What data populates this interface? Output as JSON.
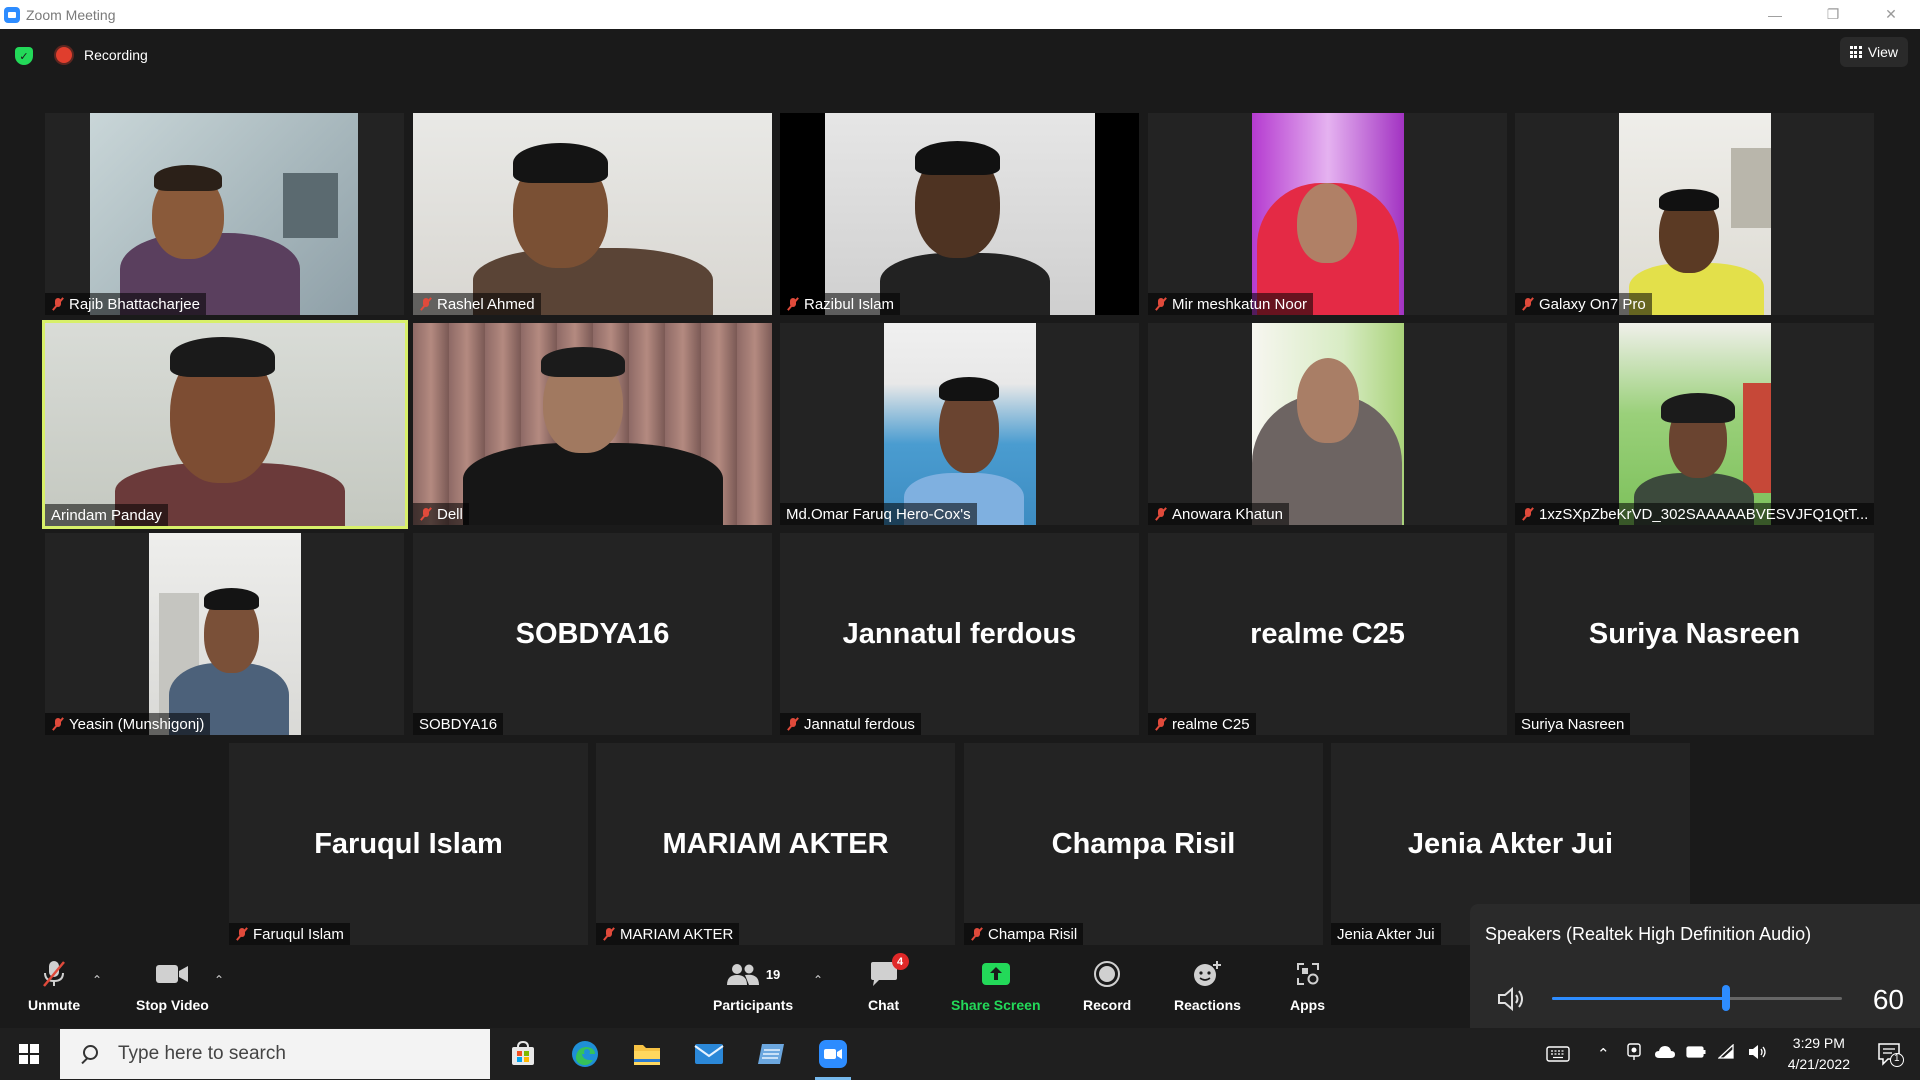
{
  "window": {
    "title": "Zoom Meeting"
  },
  "topbar": {
    "recording_label": "Recording",
    "view_label": "View"
  },
  "participants": [
    {
      "name": "Rajib Bhattacharjee",
      "muted": true,
      "video": true
    },
    {
      "name": "Rashel Ahmed",
      "muted": true,
      "video": true
    },
    {
      "name": "Razibul Islam",
      "muted": true,
      "video": true
    },
    {
      "name": "Mir meshkatun Noor",
      "muted": true,
      "video": true
    },
    {
      "name": "Galaxy On7 Pro",
      "muted": true,
      "video": true
    },
    {
      "name": "Arindam Panday",
      "muted": false,
      "video": true,
      "speaking": true
    },
    {
      "name": "Dell",
      "muted": true,
      "video": true
    },
    {
      "name": "Md.Omar Faruq Hero-Cox's",
      "muted": false,
      "video": true
    },
    {
      "name": "Anowara Khatun",
      "muted": true,
      "video": true
    },
    {
      "name": "1xzSXpZbeKrVD_302SAAAAABVESVJFQ1QtT...",
      "muted": true,
      "video": true
    },
    {
      "name": "Yeasin (Munshigonj)",
      "muted": true,
      "video": true
    },
    {
      "name": "SOBDYA16",
      "muted": false,
      "video": false
    },
    {
      "name": "Jannatul ferdous",
      "muted": true,
      "video": false
    },
    {
      "name": "realme C25",
      "muted": true,
      "video": false
    },
    {
      "name": "Suriya Nasreen",
      "muted": false,
      "video": false
    },
    {
      "name": "Faruqul Islam",
      "muted": true,
      "video": false
    },
    {
      "name": "MARIAM AKTER",
      "muted": true,
      "video": false
    },
    {
      "name": "Champa Risil",
      "muted": true,
      "video": false
    },
    {
      "name": "Jenia Akter Jui",
      "muted": false,
      "video": false
    }
  ],
  "toolbar": {
    "unmute": "Unmute",
    "stop_video": "Stop Video",
    "participants": "Participants",
    "participants_count": "19",
    "chat": "Chat",
    "chat_badge": "4",
    "share_screen": "Share Screen",
    "record": "Record",
    "reactions": "Reactions",
    "apps": "Apps"
  },
  "speaker_popup": {
    "device": "Speakers (Realtek High Definition Audio)",
    "volume": "60",
    "volume_level": 0.6
  },
  "taskbar": {
    "search_placeholder": "Type here to search",
    "time": "3:29 PM",
    "date": "4/21/2022",
    "notification_count": "1"
  },
  "colors": {
    "accent_blue": "#2d8cff",
    "share_green": "#23d959",
    "active_speaker": "#d8f06a",
    "recording_red": "#e03e2d",
    "muted_red": "#e04a3b"
  }
}
